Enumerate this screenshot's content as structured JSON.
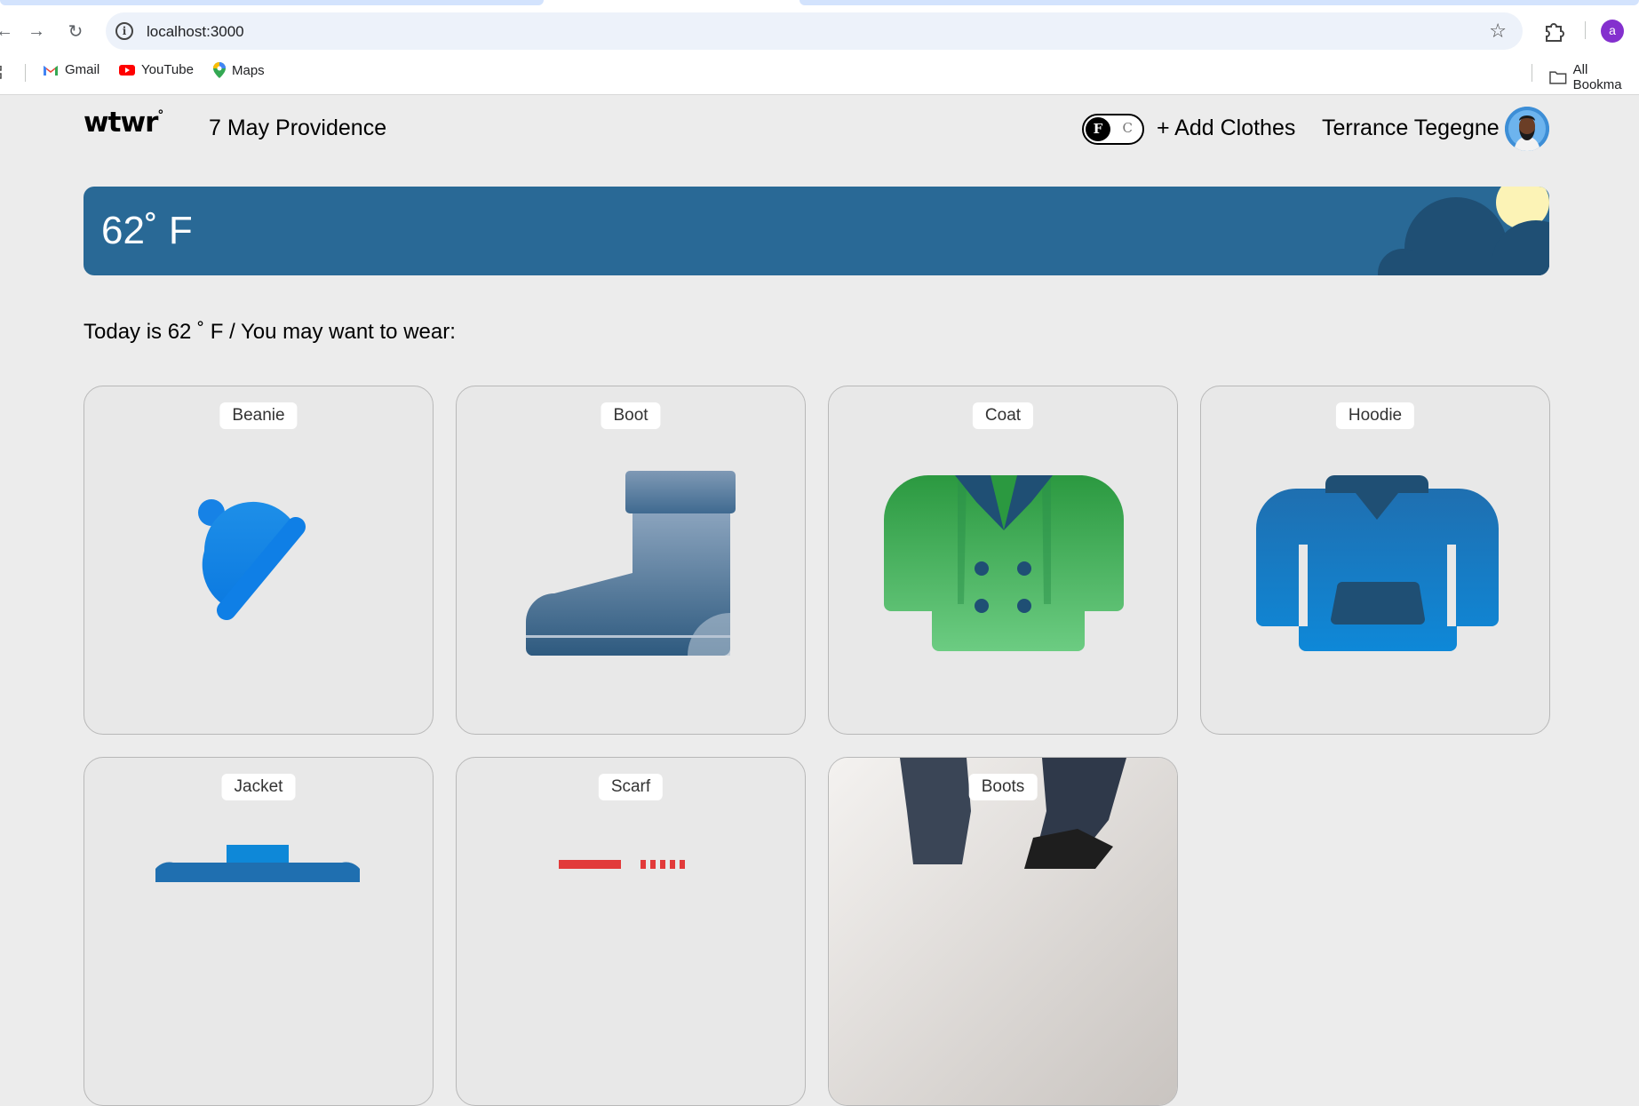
{
  "browser": {
    "url": "localhost:3000",
    "profile_initial": "a",
    "bookmarks": [
      {
        "label": "Gmail",
        "icon": "gmail-icon"
      },
      {
        "label": "YouTube",
        "icon": "youtube-icon"
      },
      {
        "label": "Maps",
        "icon": "maps-icon"
      }
    ],
    "all_bookmarks_label": "All Bookma"
  },
  "header": {
    "logo": "wtwr",
    "logo_degree": "°",
    "date_location": "7 May Providence",
    "toggle": {
      "active": "F",
      "inactive": "C"
    },
    "add_clothes": "+ Add Clothes",
    "username": "Terrance Tegegne"
  },
  "weather": {
    "temperature": "62˚ F",
    "colors": {
      "card": "#296996",
      "cloud": "#1f4f74",
      "sun": "#fcf3b6"
    }
  },
  "main": {
    "recommendation": "Today is 62 ˚ F / You may want to wear:"
  },
  "items": [
    {
      "name": "Beanie",
      "icon": "beanie-icon"
    },
    {
      "name": "Boot",
      "icon": "boot-icon"
    },
    {
      "name": "Coat",
      "icon": "coat-icon"
    },
    {
      "name": "Hoodie",
      "icon": "hoodie-icon"
    },
    {
      "name": "Jacket",
      "icon": "jacket-icon"
    },
    {
      "name": "Scarf",
      "icon": "scarf-icon"
    },
    {
      "name": "Boots",
      "icon": "boots-photo"
    }
  ]
}
